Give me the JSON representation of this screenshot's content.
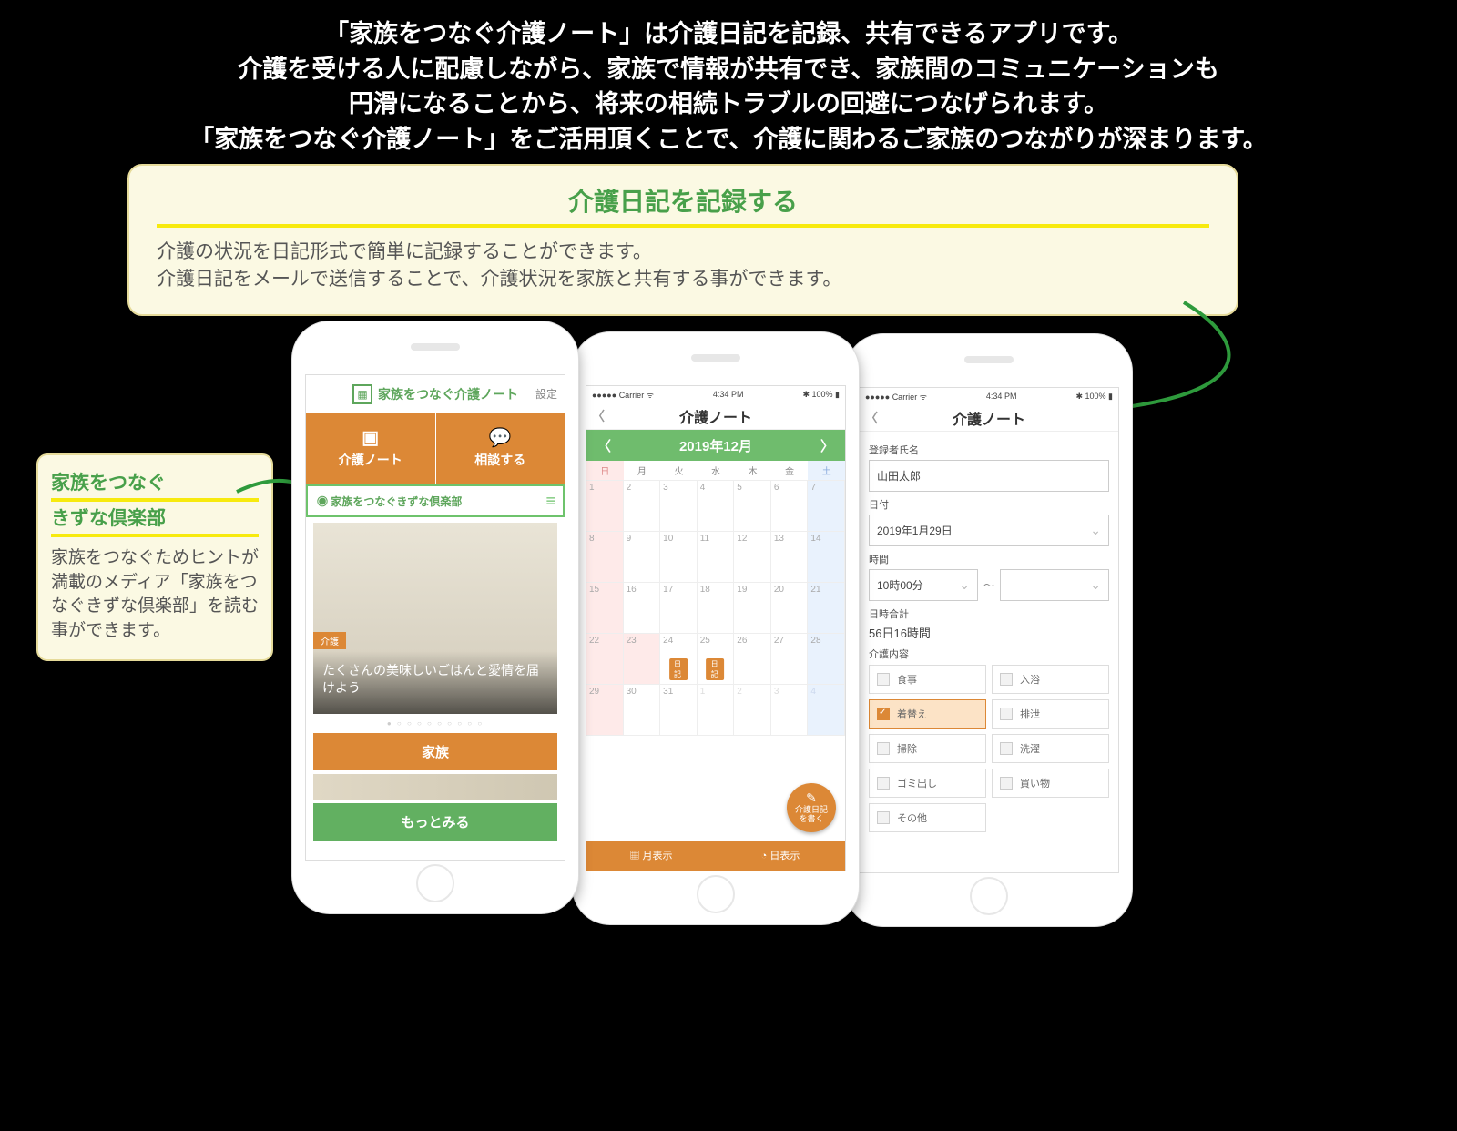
{
  "header": {
    "text": "「家族をつなぐ介護ノート」は介護日記を記録、共有できるアプリです。\n介護を受ける人に配慮しながら、家族で情報が共有でき、家族間のコミュニケーションも\n円滑になることから、将来の相続トラブルの回避につなげられます。\n「家族をつなぐ介護ノート」をご活用頂くことで、介護に関わるご家族のつながりが深まります。"
  },
  "feature": {
    "title": "介護日記を記録する",
    "body": "介護の状況を日記形式で簡単に記録することができます。\n介護日記をメールで送信することで、介護状況を家族と共有する事ができます。"
  },
  "side": {
    "title1": "家族をつなぐ",
    "title2": "きずな倶楽部",
    "body": "家族をつなぐためヒントが満載のメディア「家族をつなぐきずな倶楽部」を読む事ができます。"
  },
  "phone1": {
    "title": "家族をつなぐ介護ノート",
    "settings": "設定",
    "tab1": "介護ノート",
    "tab2": "相談する",
    "kizuna": "家族をつなぐきずな倶楽部",
    "article_tag": "介護",
    "article_text": "たくさんの美味しいごはんと愛情を届けよう",
    "btn_family": "家族",
    "btn_more": "もっとみる"
  },
  "phone2": {
    "carrier": "Carrier",
    "time": "4:34 PM",
    "battery": "100%",
    "title": "介護ノート",
    "month": "2019年12月",
    "dow": [
      "日",
      "月",
      "火",
      "水",
      "木",
      "金",
      "土"
    ],
    "week1": [
      "1",
      "2",
      "3",
      "4",
      "5",
      "6",
      "7"
    ],
    "week2": [
      "8",
      "9",
      "10",
      "11",
      "12",
      "13",
      "14"
    ],
    "week3": [
      "15",
      "16",
      "17",
      "18",
      "19",
      "20",
      "21"
    ],
    "week4": [
      "22",
      "23",
      "24",
      "25",
      "26",
      "27",
      "28"
    ],
    "week5": [
      "29",
      "30",
      "31",
      "1",
      "2",
      "3",
      "4"
    ],
    "diary_label": "日記",
    "fab": "介護日記\nを書く",
    "footer_month": "月表示",
    "footer_day": "日表示"
  },
  "phone3": {
    "carrier": "Carrier",
    "time": "4:34 PM",
    "battery": "100%",
    "title": "介護ノート",
    "label_name": "登録者氏名",
    "name": "山田太郎",
    "label_date": "日付",
    "date": "2019年1月29日",
    "label_time": "時間",
    "time_from": "10時00分",
    "time_sep": "〜",
    "label_total": "日時合計",
    "total": "56日16時間",
    "label_content": "介護内容",
    "opts": {
      "meal": "食事",
      "bath": "入浴",
      "dress": "着替え",
      "toilet": "排泄",
      "clean": "掃除",
      "laundry": "洗濯",
      "trash": "ゴミ出し",
      "shop": "買い物",
      "other": "その他"
    }
  }
}
